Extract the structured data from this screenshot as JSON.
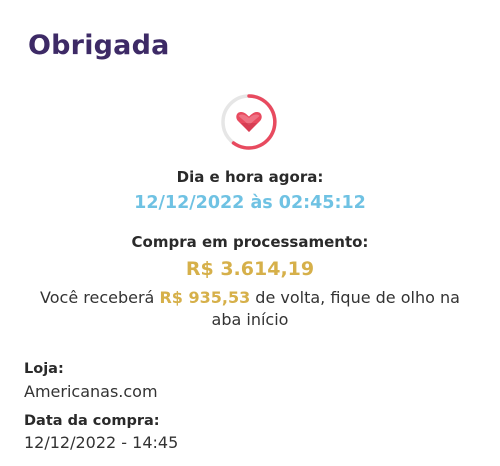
{
  "header": {
    "title": "Obrigada"
  },
  "status": {
    "icon": "heart-icon",
    "ring_color": "#e84a5f",
    "ring_track_color": "#d9d9d9"
  },
  "datetime": {
    "label": "Dia e hora agora:",
    "value": "12/12/2022 às 02:45:12"
  },
  "purchase": {
    "status_label": "Compra em processamento:",
    "amount": "R$ 3.614,19",
    "cashback_prefix": "Você receberá ",
    "cashback_amount": "R$ 935,53",
    "cashback_suffix": " de volta, fique de olho na aba início"
  },
  "details": {
    "store_label": "Loja:",
    "store_value": "Americanas.com",
    "date_label": "Data da compra:",
    "date_value": "12/12/2022 - 14:45"
  },
  "colors": {
    "title": "#3d2a66",
    "datetime": "#6fc2e3",
    "amount": "#d6b04a",
    "heart": "#e84a5f"
  }
}
